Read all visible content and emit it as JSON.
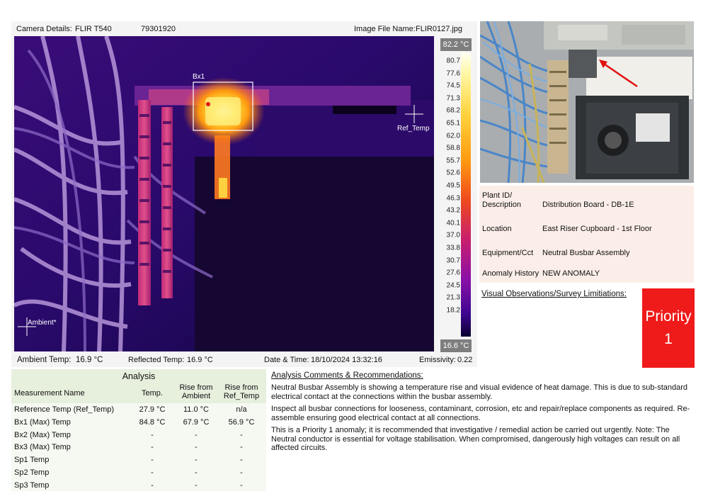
{
  "camera": {
    "label": "Camera Details:",
    "model": "FLIR T540",
    "serial": "79301920",
    "file_label": "Image File Name:",
    "file_name": "FLIR0127.jpg"
  },
  "thermal": {
    "box_label": "Bx1",
    "ref_label": "Ref_Temp",
    "ambient_label": "Ambient*"
  },
  "scale": {
    "max": "82.2 °C",
    "min": "16.6 °C",
    "ticks": [
      "80.7",
      "77.6",
      "74.5",
      "71.3",
      "68.2",
      "65.1",
      "62.0",
      "58.8",
      "55.7",
      "52.6",
      "49.5",
      "46.3",
      "43.2",
      "40.1",
      "37.0",
      "33.8",
      "30.7",
      "27.6",
      "24.5",
      "21.3",
      "18.2"
    ]
  },
  "conditions": {
    "ambient_label": "Ambient Temp:",
    "ambient_value": "16.9 °C",
    "reflected_label": "Reflected Temp:",
    "reflected_value": "16.9 °C",
    "datetime_label": "Date & Time:",
    "datetime_value": "18/10/2024 13:32:16",
    "emissivity_label": "Emissivity:",
    "emissivity_value": "0.22"
  },
  "details": [
    {
      "label": "Plant ID/ Description",
      "value": "Distribution Board - DB-1E"
    },
    {
      "label": "Location",
      "value": "East Riser Cupboard - 1st Floor"
    },
    {
      "label": "Equipment/Cct",
      "value": "Neutral Busbar Assembly"
    },
    {
      "label": "Anomaly History",
      "value": "NEW ANOMALY"
    }
  ],
  "visual_title": "Visual Observations/Survey Limitiations:",
  "priority": {
    "label": "Priority",
    "level": "1",
    "color": "#ef1a1a"
  },
  "analysis": {
    "title": "Analysis",
    "headers": [
      "Measurement Name",
      "Temp.",
      "Rise from Ambient",
      "Rise from Ref_Temp"
    ],
    "rows": [
      [
        "Reference Temp (Ref_Temp)",
        "27.9 °C",
        "11.0 °C",
        "n/a"
      ],
      [
        "Bx1 (Max) Temp",
        "84.8 °C",
        "67.9 °C",
        "56.9 °C"
      ],
      [
        "Bx2 (Max) Temp",
        "-",
        "-",
        "-"
      ],
      [
        "Bx3 (Max) Temp",
        "-",
        "-",
        "-"
      ],
      [
        "Sp1 Temp",
        "-",
        "-",
        "-"
      ],
      [
        "Sp2 Temp",
        "-",
        "-",
        "-"
      ],
      [
        "Sp3 Temp",
        "-",
        "-",
        "-"
      ]
    ]
  },
  "comments": {
    "title": "Analysis Comments & Recommendations:",
    "paragraphs": [
      "Neutral Busbar Assembly is showing a temperature rise and visual evidence of heat damage. This is due to sub-standard electrical contact at the connections within the busbar assembly.",
      "Inspect all busbar connections for looseness, contaminant, corrosion, etc and repair/replace components as required. Re-assemble ensuring good electrical contact at all connections.",
      "This is a Priority 1 anomaly; it is recommended that investigative / remedial action be carried out urgently. Note: The Neutral conductor is essential for voltage stabilisation. When compromised, dangerously high voltages can result on all affected circuits."
    ]
  }
}
